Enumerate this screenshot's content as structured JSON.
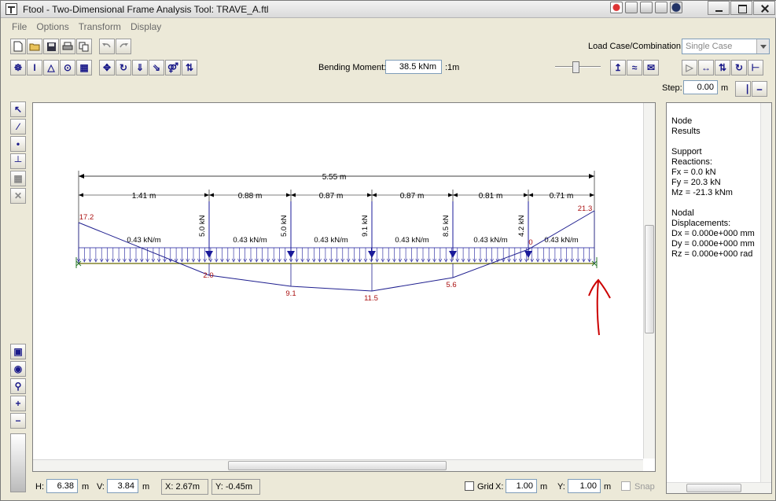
{
  "window": {
    "title": "Ftool - Two-Dimensional Frame Analysis Tool: TRAVE_A.ftl"
  },
  "menu": [
    "File",
    "Options",
    "Transform",
    "Display"
  ],
  "toolbar": {
    "load_case_label": "Load Case/Combination:",
    "load_case_value": "Single Case",
    "bending_moment_label": "Bending Moment:",
    "bending_moment_value": "38.5 kNm",
    "bending_moment_unit": ":1m",
    "step_label": "Step:",
    "step_value": "0.00",
    "step_unit": "m"
  },
  "results_panel": {
    "text": "Node\nResults\n\nSupport\nReactions:\nFx = 0.0 kN\nFy = 20.3 kN\nMz = -21.3 kNm\n\nNodal\nDisplacements:\nDx = 0.000e+000 mm\nDy = 0.000e+000 mm\nRz = 0.000e+000 rad"
  },
  "status": {
    "h_label": "H:",
    "h_value": "6.38",
    "h_unit": "m",
    "v_label": "V:",
    "v_value": "3.84",
    "v_unit": "m",
    "x_coord": "X: 2.67m",
    "y_coord": "Y: -0.45m",
    "grid_label": "Grid",
    "grid_x_label": "X:",
    "grid_x_value": "1.00",
    "grid_x_unit": "m",
    "grid_y_label": "Y:",
    "grid_y_value": "1.00",
    "grid_y_unit": "m",
    "snap_label": "Snap"
  },
  "drawing": {
    "total_span": "5.55 m",
    "spans": [
      "1.41 m",
      "0.88 m",
      "0.87 m",
      "0.87 m",
      "0.81 m",
      "0.71 m"
    ],
    "point_loads": [
      "5.0 kN",
      "5.0 kN",
      "9.1 kN",
      "8.5 kN",
      "4.2 kN"
    ],
    "distributed_load": "0.43 kN/m",
    "moment_labels": [
      "17.2",
      "2.0",
      "9.1",
      "11.5",
      "5.6",
      "0",
      "21.3"
    ],
    "colors": {
      "dimension": "#000000",
      "load": "#1a1a9a",
      "diagram": "#1f1f8f",
      "moment_text": "#aa1111",
      "beam": "#6b6b00",
      "annotation": "#cc0000"
    }
  }
}
